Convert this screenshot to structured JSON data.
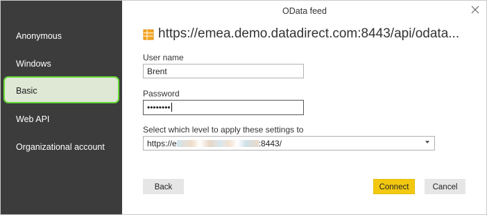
{
  "dialog": {
    "title": "OData feed"
  },
  "sidebar": {
    "items": [
      {
        "label": "Anonymous"
      },
      {
        "label": "Windows"
      },
      {
        "label": "Basic"
      },
      {
        "label": "Web API"
      },
      {
        "label": "Organizational account"
      }
    ],
    "selected": "Basic"
  },
  "source": {
    "url": "https://emea.demo.datadirect.com:8443/api/odata...",
    "icon": "table-icon"
  },
  "form": {
    "username_label": "User name",
    "username_value": "Brent",
    "password_label": "Password",
    "password_value": "••••••••",
    "level_label": "Select which level to apply these settings to",
    "level_value_prefix": "https://e",
    "level_value_suffix": ":8443/"
  },
  "buttons": {
    "back": "Back",
    "connect": "Connect",
    "cancel": "Cancel"
  },
  "colors": {
    "sidebar": "#3c3c3c",
    "selected_highlight": "#69dc3a",
    "accent": "#f2c811"
  }
}
